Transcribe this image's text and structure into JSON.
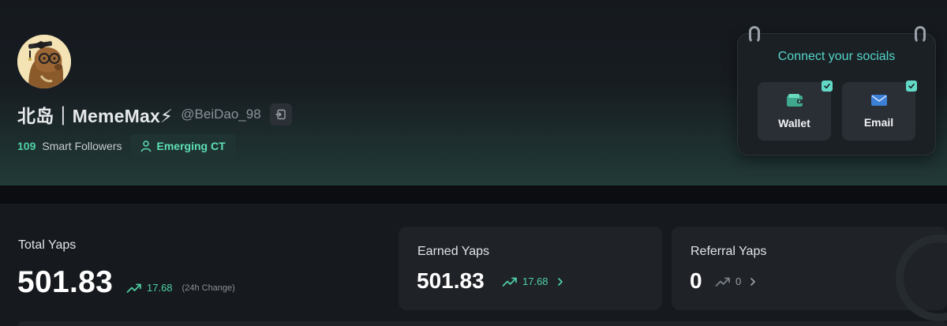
{
  "profile": {
    "display_name": "北岛｜MemeMax⚡",
    "handle": "@BeiDao_98",
    "smart_followers_count": "109",
    "smart_followers_label": "Smart Followers",
    "badge_label": "Emerging CT"
  },
  "socials": {
    "title": "Connect your socials",
    "wallet_label": "Wallet",
    "email_label": "Email"
  },
  "yaps": {
    "total": {
      "label": "Total Yaps",
      "value": "501.83",
      "change": "17.68",
      "change_note": "(24h Change)"
    },
    "earned": {
      "label": "Earned Yaps",
      "value": "501.83",
      "change": "17.68"
    },
    "referral": {
      "label": "Referral Yaps",
      "value": "0",
      "change": "0"
    }
  },
  "colors": {
    "accent_green": "#4fd1a5",
    "accent_teal": "#53d6c8",
    "card_bg": "#1f2328",
    "page_bg": "#0b0d10"
  }
}
